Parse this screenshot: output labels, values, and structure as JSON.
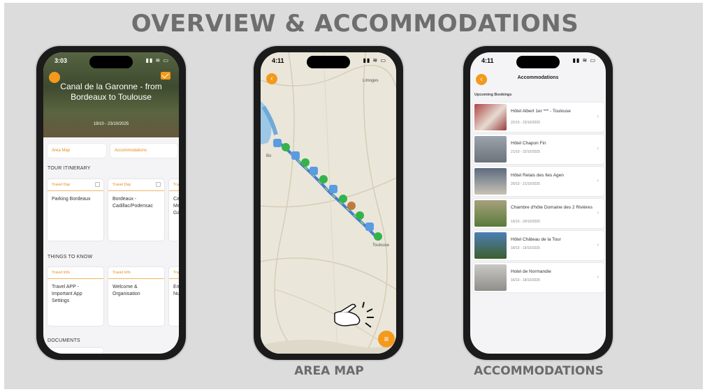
{
  "slide": {
    "heading": "OVERVIEW & ACCOMMODATIONS",
    "captions": {
      "area_map": "AREA MAP",
      "accommodations": "ACCOMMODATIONS"
    }
  },
  "phone_overview": {
    "status_time": "3:03",
    "hero_title": "Canal de la Garonne - from Bordeaux to Toulouse",
    "hero_dates": "19/10 - 23/10/2025",
    "quick_links": [
      "Area Map",
      "Accommodations"
    ],
    "tour_itinerary_label": "TOUR ITINERARY",
    "itinerary_cards": [
      {
        "tag": "Travel Day",
        "text": "Parking Bordeaux"
      },
      {
        "tag": "Travel Day",
        "text": "Bordeaux - Cadillac/Podensac"
      },
      {
        "tag": "Tra",
        "text": "Ca... Me... Ga..."
      }
    ],
    "things_label": "THINGS TO KNOW",
    "info_cards": [
      {
        "tag": "Travel Info",
        "text": "Travel APP - Important App Settings"
      },
      {
        "tag": "Travel Info",
        "text": "Welcome & Organisation"
      },
      {
        "tag": "Tra",
        "text": "Em... Nu..."
      }
    ],
    "documents_label": "DOCUMENTS"
  },
  "phone_map": {
    "status_time": "4:11",
    "labels": {
      "top_city": "Limoges",
      "left_city": "Bo",
      "bottom_city": "Toulouse"
    },
    "filter_icon": "filter-icon",
    "route_color": "#4a7bd1",
    "pin_color": "#2ea84a"
  },
  "phone_accommodations": {
    "status_time": "4:11",
    "title": "Accommodations",
    "section": "Upcoming Bookings",
    "bookings": [
      {
        "name": "Hôtel Albert 1er *** - Toulouse",
        "dates": "22/10 - 23/10/2025",
        "thumb": "#9a3b3b"
      },
      {
        "name": "Hôtel Chapon Fin",
        "dates": "21/10 - 22/10/2025",
        "thumb": "#8a8f96"
      },
      {
        "name": "Hôtel Relais des Iles Agen",
        "dates": "20/10 - 21/10/2025",
        "thumb": "#6d7d90"
      },
      {
        "name": "Chambre d'hôte Domaine des 2 Rivières",
        "dates": "19/10 - 20/10/2025",
        "thumb": "#8d8a6a"
      },
      {
        "name": "Hôtel Château de la Tour",
        "dates": "18/10 - 19/10/2025",
        "thumb": "#4f6b3d"
      },
      {
        "name": "Hotel de Normandie",
        "dates": "16/10 - 18/10/2025",
        "thumb": "#b8b7b3"
      }
    ]
  }
}
